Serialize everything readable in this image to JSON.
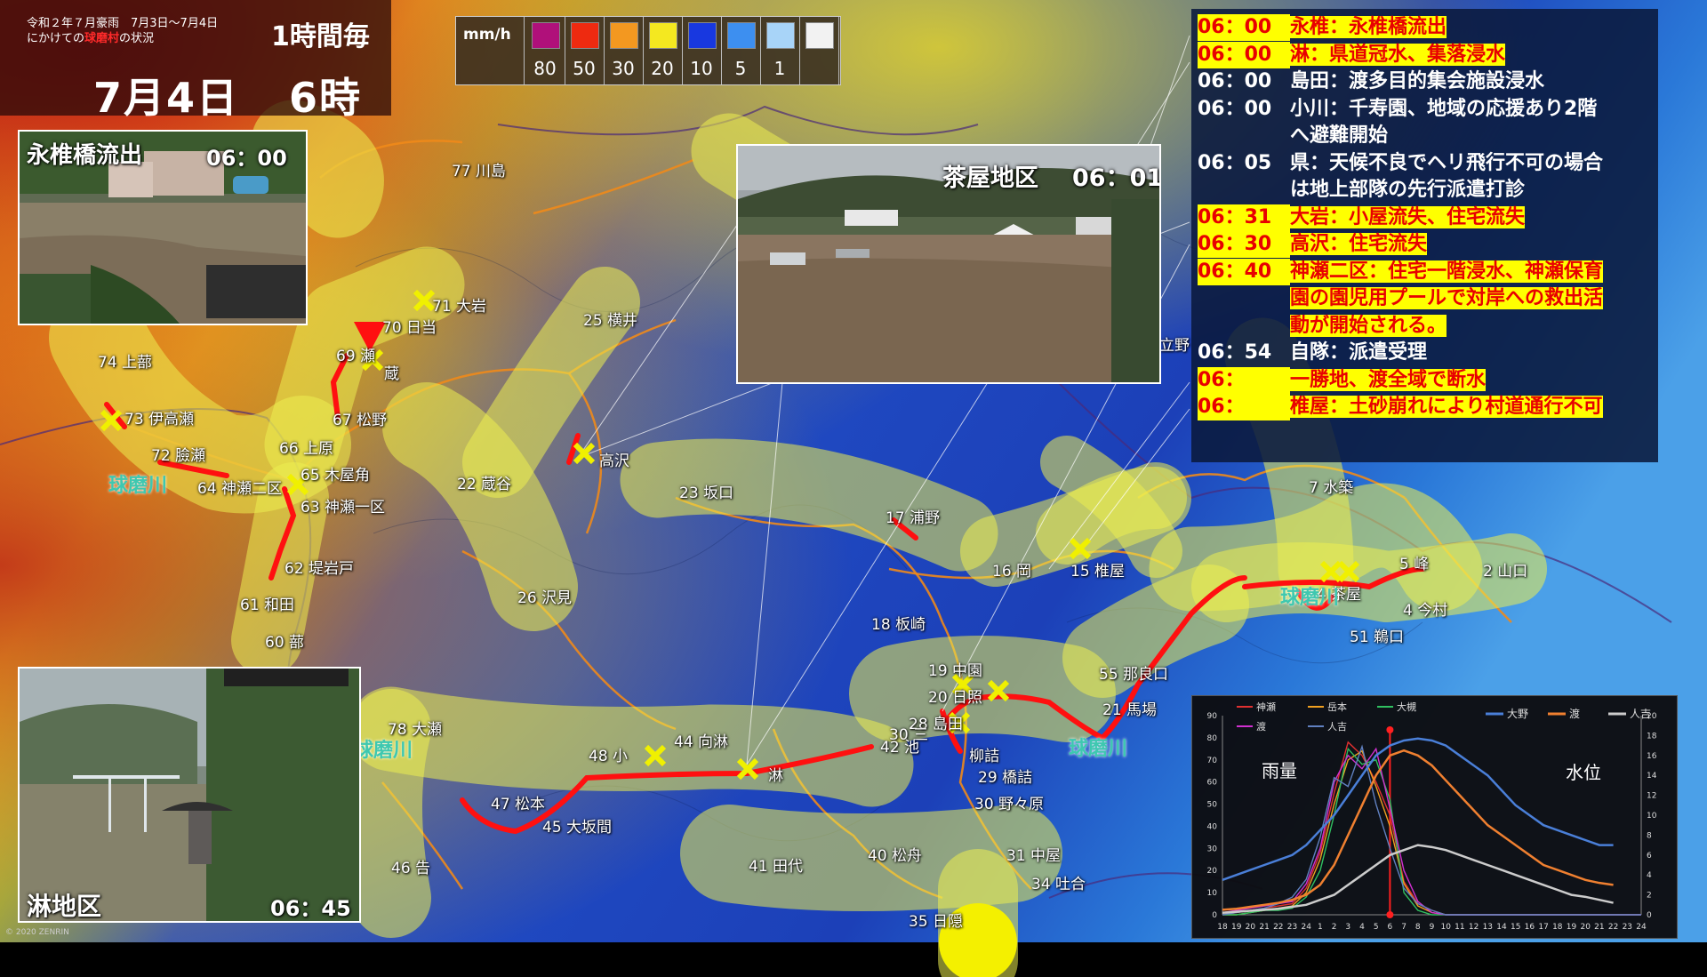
{
  "header": {
    "subtitle_line1": "令和２年７月豪雨　7月3日〜7月4日",
    "subtitle_line2_pre": "にかけての",
    "subtitle_highlight": "球磨村",
    "subtitle_line2_post": "の状況",
    "interval": "1時間毎",
    "date": "7月4日",
    "hour": "6時"
  },
  "legend": {
    "unit": "mm/h",
    "swatches": [
      {
        "color": "#b0107a",
        "label": "80"
      },
      {
        "color": "#ee2a10",
        "label": "50"
      },
      {
        "color": "#f39820",
        "label": "30"
      },
      {
        "color": "#f4e820",
        "label": "20"
      },
      {
        "color": "#1838e0",
        "label": "10"
      },
      {
        "color": "#3d8ff0",
        "label": "5"
      },
      {
        "color": "#a8d4f8",
        "label": "1"
      },
      {
        "color": "#f2f2f2",
        "label": ""
      }
    ]
  },
  "photos": {
    "eishii": {
      "title": "永椎橋流出",
      "time": "06：00"
    },
    "chaya": {
      "title": "茶屋地区",
      "time": "06：01"
    },
    "sabi": {
      "title": "淋地区",
      "time": "06：45"
    }
  },
  "timeline": [
    {
      "time": "06：00",
      "text": "永椎：永椎橋流出",
      "red": true
    },
    {
      "time": "06：00",
      "text": "淋：県道冠水、集落浸水",
      "red": true
    },
    {
      "time": "06：00",
      "text": "島田：渡多目的集会施設浸水",
      "red": false
    },
    {
      "time": "06：00",
      "text": "小川：千寿園、地域の応援あり2階",
      "red": false
    },
    {
      "time": "",
      "text": "へ避難開始",
      "red": false
    },
    {
      "time": "06：05",
      "text": "県：天候不良でヘリ飛行不可の場合",
      "red": false
    },
    {
      "time": "",
      "text": "は地上部隊の先行派遣打診",
      "red": false
    },
    {
      "time": "06：31",
      "text": "大岩：小屋流失、住宅流失",
      "red": true
    },
    {
      "time": "06：30",
      "text": "高沢：住宅流失",
      "red": true
    },
    {
      "time": "06：40",
      "text": "神瀬二区：住宅一階浸水、神瀬保育",
      "red": true
    },
    {
      "time": "",
      "text": "園の園児用プールで対岸への救出活",
      "red": true
    },
    {
      "time": "",
      "text": "動が開始される。",
      "red": true
    },
    {
      "time": "06：54",
      "text": "自隊：派遣受理",
      "red": false
    },
    {
      "time": "06：",
      "text": "一勝地、渡全域で断水",
      "red": true
    },
    {
      "time": "06：",
      "text": "椎屋：土砂崩れにより村道通行不可",
      "red": true
    }
  ],
  "places": [
    {
      "name": "74 上蔀"
    },
    {
      "name": "73 伊高瀬"
    },
    {
      "name": "72 臉瀬"
    },
    {
      "name": "64 神瀬二区"
    },
    {
      "name": "71 大岩"
    },
    {
      "name": "70 日当"
    },
    {
      "name": "69 瀬"
    },
    {
      "name": "蔵"
    },
    {
      "name": "67 松野"
    },
    {
      "name": "66 上原"
    },
    {
      "name": "65 木屋角"
    },
    {
      "name": "63 神瀬一区"
    },
    {
      "name": "62 堤岩戸"
    },
    {
      "name": "61 和田"
    },
    {
      "name": "60 蔀"
    },
    {
      "name": "77 川島"
    },
    {
      "name": "25 横井"
    },
    {
      "name": "高沢"
    },
    {
      "name": "22 蔵谷"
    },
    {
      "name": "23 坂口"
    },
    {
      "name": "26 沢見"
    },
    {
      "name": "17 浦野"
    },
    {
      "name": "18 板崎"
    },
    {
      "name": "16 岡"
    },
    {
      "name": "15 椎屋"
    },
    {
      "name": "7 水築"
    },
    {
      "name": "14 茶屋"
    },
    {
      "name": "5 峰"
    },
    {
      "name": "2 山口"
    },
    {
      "name": "4 今村"
    },
    {
      "name": "51 鵜口"
    },
    {
      "name": "55 那良口"
    },
    {
      "name": "21 馬場"
    },
    {
      "name": "19 中園"
    },
    {
      "name": "20 日照"
    },
    {
      "name": "28 島田"
    },
    {
      "name": "30 三"
    },
    {
      "name": "42 池"
    },
    {
      "name": "柳詰"
    },
    {
      "name": "29 橋詰"
    },
    {
      "name": "30 野々原"
    },
    {
      "name": "31 中屋"
    },
    {
      "name": "34 吐合"
    },
    {
      "name": "35 日隠"
    },
    {
      "name": "40 松舟"
    },
    {
      "name": "41 田代"
    },
    {
      "name": "78 大瀬"
    },
    {
      "name": "48 小"
    },
    {
      "name": "44 向淋"
    },
    {
      "name": "淋"
    },
    {
      "name": "47 松本"
    },
    {
      "name": "45 大坂間"
    },
    {
      "name": "46 告"
    },
    {
      "name": "立野"
    }
  ],
  "rivers": [
    "球磨川",
    "球磨川",
    "球磨川",
    "球磨川"
  ],
  "copyright": "© 2020 ZENRIN",
  "chart_data": {
    "type": "line",
    "title": "",
    "legend_rain": [
      "神瀬",
      "岳本",
      "大槻",
      "渡",
      "人吉"
    ],
    "legend_level": [
      "大野",
      "渡",
      "人吉"
    ],
    "label_left": "雨量",
    "label_right": "水位",
    "x": [
      "18",
      "19",
      "20",
      "21",
      "22",
      "23",
      "24",
      "1",
      "2",
      "3",
      "4",
      "5",
      "6",
      "7",
      "8",
      "9",
      "10",
      "11",
      "12",
      "13",
      "14",
      "15",
      "16",
      "17",
      "18",
      "19",
      "20",
      "21",
      "22",
      "23",
      "24"
    ],
    "y_left_ticks": [
      "0",
      "10",
      "20",
      "30",
      "40",
      "50",
      "60",
      "70",
      "80",
      "90"
    ],
    "y_right_ticks": [
      "0",
      "2",
      "4",
      "6",
      "8",
      "10",
      "12",
      "14",
      "16",
      "18",
      "20"
    ],
    "ylim_left": [
      0,
      90
    ],
    "ylim_right": [
      0,
      20
    ],
    "current_time": "6",
    "rain_series": [
      {
        "name": "神瀬",
        "color": "#e03030",
        "values": [
          0,
          1,
          2,
          3,
          4,
          5,
          12,
          28,
          55,
          78,
          72,
          60,
          45,
          15,
          5,
          2,
          0,
          0,
          0,
          0,
          0,
          0,
          0,
          0,
          0,
          0,
          0,
          0,
          0,
          0,
          0
        ]
      },
      {
        "name": "岳本",
        "color": "#f0a020",
        "values": [
          0,
          0,
          1,
          2,
          3,
          4,
          10,
          25,
          50,
          70,
          74,
          58,
          40,
          14,
          4,
          1,
          0,
          0,
          0,
          0,
          0,
          0,
          0,
          0,
          0,
          0,
          0,
          0,
          0,
          0,
          0
        ]
      },
      {
        "name": "大槻",
        "color": "#30c060",
        "values": [
          0,
          0,
          1,
          2,
          2,
          3,
          8,
          20,
          45,
          75,
          68,
          70,
          52,
          10,
          2,
          0,
          0,
          0,
          0,
          0,
          0,
          0,
          0,
          0,
          0,
          0,
          0,
          0,
          0,
          0,
          0
        ]
      },
      {
        "name": "渡",
        "color": "#d030d0",
        "values": [
          1,
          2,
          3,
          4,
          5,
          6,
          14,
          30,
          60,
          72,
          66,
          75,
          48,
          20,
          6,
          1,
          0,
          0,
          0,
          0,
          0,
          0,
          0,
          0,
          0,
          0,
          0,
          0,
          0,
          0,
          0
        ]
      },
      {
        "name": "人吉",
        "color": "#6080c0",
        "values": [
          0,
          1,
          2,
          3,
          5,
          8,
          16,
          35,
          62,
          58,
          76,
          50,
          30,
          12,
          5,
          2,
          0,
          0,
          0,
          0,
          0,
          0,
          0,
          0,
          0,
          0,
          0,
          0,
          0,
          0,
          0
        ]
      }
    ],
    "level_series": [
      {
        "name": "大野",
        "color": "#4a7fd8",
        "values": [
          3.5,
          4,
          4.5,
          5,
          5.5,
          6,
          7,
          8.5,
          10,
          12,
          14,
          16,
          17,
          17.5,
          17.7,
          17.5,
          17,
          16,
          15,
          14,
          12.5,
          11,
          10,
          9,
          8.5,
          8,
          7.5,
          7,
          7
        ]
      },
      {
        "name": "渡",
        "color": "#f08030",
        "values": [
          0.5,
          0.6,
          0.8,
          1,
          1.2,
          1.5,
          2,
          3,
          5,
          8,
          11,
          14,
          16,
          16.5,
          16,
          15,
          13.5,
          12,
          10.5,
          9,
          8,
          7,
          6,
          5,
          4.5,
          4,
          3.5,
          3.2,
          3
        ]
      },
      {
        "name": "人吉",
        "color": "#cccccc",
        "values": [
          0.2,
          0.3,
          0.4,
          0.5,
          0.6,
          0.8,
          1,
          1.5,
          2,
          3,
          4,
          5,
          6,
          6.5,
          7,
          6.8,
          6.5,
          6,
          5.5,
          5,
          4.5,
          4,
          3.5,
          3,
          2.5,
          2,
          1.8,
          1.5,
          1.2
        ]
      }
    ]
  }
}
